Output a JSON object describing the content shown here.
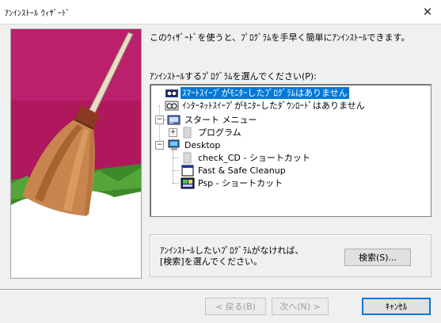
{
  "window": {
    "title": "ｱﾝｲﾝｽﾄｰﾙ ｳｨｻﾞｰﾄﾞ",
    "close_symbol": "✕"
  },
  "intro_text": "このｳｨｻﾞｰﾄﾞを使うと、ﾌﾟﾛｸﾞﾗﾑを手早く簡単にｱﾝｲﾝｽﾄｰﾙできます。",
  "tree_label": "ｱﾝｲﾝｽﾄｰﾙするﾌﾟﾛｸﾞﾗﾑを選んでください(P):",
  "tree": [
    {
      "label": "ｽﾏｰﾄｽｲｰﾌﾟがﾓﾆﾀｰしたﾌﾟﾛｸﾞﾗﾑはありません",
      "icon": "sweep-glasses-icon",
      "selected": true
    },
    {
      "label": "ｲﾝﾀｰﾈｯﾄｽｲｰﾌﾟがﾓﾆﾀｰしたﾀﾞｳﾝﾛｰﾄﾞはありません",
      "icon": "internet-sweep-icon",
      "selected": false
    },
    {
      "label": "スタート メニュー",
      "icon": "start-menu-icon",
      "expander": "−"
    },
    {
      "label": "プログラム",
      "icon": "folder-icon",
      "expander": "+"
    },
    {
      "label": "Desktop",
      "icon": "desktop-icon",
      "expander": "−"
    },
    {
      "label": "check_CD - ショートカット",
      "icon": "shortcut-file-icon"
    },
    {
      "label": "Fast & Safe Cleanup",
      "icon": "app-window-icon"
    },
    {
      "label": "Psp - ショートカット",
      "icon": "psp-shortcut-icon"
    }
  ],
  "search_group": {
    "text_line1": "ｱﾝｲﾝｽﾄｰﾙしたいﾌﾟﾛｸﾞﾗﾑがなければ、",
    "text_line2": "[検索]を選んでください。",
    "search_button": "検索(S)..."
  },
  "buttons": {
    "back": "< 戻る(B)",
    "next": "次へ(N) >",
    "cancel": "ｷｬﾝｾﾙ"
  },
  "colors": {
    "selection": "#0078d7",
    "background": "#f0f0f0",
    "magenta": "#b0185e"
  }
}
